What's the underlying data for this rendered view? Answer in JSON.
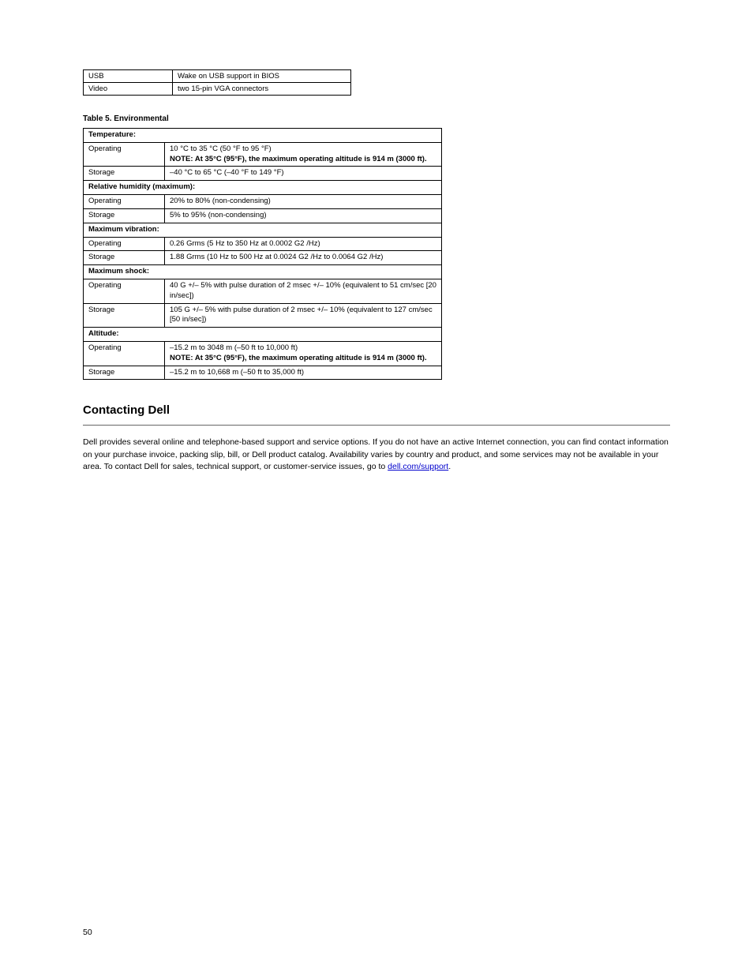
{
  "top_table": {
    "r1c1": "USB",
    "r1c2": "Wake on USB support in BIOS",
    "r2c1": "Video",
    "r2c2": "two 15-pin VGA connectors"
  },
  "env_caption": "Table 5. Environmental",
  "env": {
    "temp_header": "Temperature:",
    "temp_op_label": "Operating",
    "temp_op_value": "10 °C to 35 °C (50 °F to 95 °F)",
    "temp_op_note_label": "NOTE:",
    "temp_op_note_text": "At 35°C (95°F), the maximum operating altitude is 914 m (3000 ft).",
    "temp_st_label": "Storage",
    "temp_st_value": "–40 °C to 65 °C (–40 °F to 149 °F)",
    "hum_header": "Relative humidity (maximum):",
    "hum_op_label": "Operating",
    "hum_op_value": "20% to 80% (non-condensing)",
    "hum_st_label": "Storage",
    "hum_st_value": "5% to 95% (non-condensing)",
    "vib_header": "Maximum vibration:",
    "vib_op_label": "Operating",
    "vib_op_value": "0.26 Grms (5 Hz to 350 Hz at 0.0002 G2 /Hz)",
    "vib_st_label": "Storage",
    "vib_st_value": "1.88 Grms (10 Hz to 500 Hz at 0.0024 G2 /Hz to 0.0064 G2 /Hz)",
    "shock_header": "Maximum shock:",
    "shock_op_label": "Operating",
    "shock_op_value": "40 G +/– 5% with pulse duration of 2 msec +/– 10% (equivalent to 51 cm/sec [20 in/sec])",
    "shock_st_label": "Storage",
    "shock_st_value": "105 G +/– 5% with pulse duration of 2 msec +/– 10% (equivalent to 127 cm/sec [50 in/sec])",
    "alt_header": "Altitude:",
    "alt_op_label": "Operating",
    "alt_op_value": "–15.2 m to 3048 m (–50 ft to 10,000 ft)",
    "alt_op_note_label": "NOTE:",
    "alt_op_note_text": "At 35°C (95°F), the maximum operating altitude is 914 m (3000 ft).",
    "alt_st_label": "Storage",
    "alt_st_value": "–15.2 m to 10,668 m (–50 ft to 35,000 ft)"
  },
  "section_title": "Contacting Dell",
  "para1_prefix": "Dell provides several online and telephone-based support and service options. If you do not have an active Internet connection, you can find contact information on your purchase invoice, packing slip, bill, or Dell product catalog. Availability varies by country and product, and some services may not be available in your area. To contact Dell for sales, technical support, or customer-service issues, go to ",
  "link_text": "dell.com/support",
  "link_href": "#",
  "page_number": "50"
}
